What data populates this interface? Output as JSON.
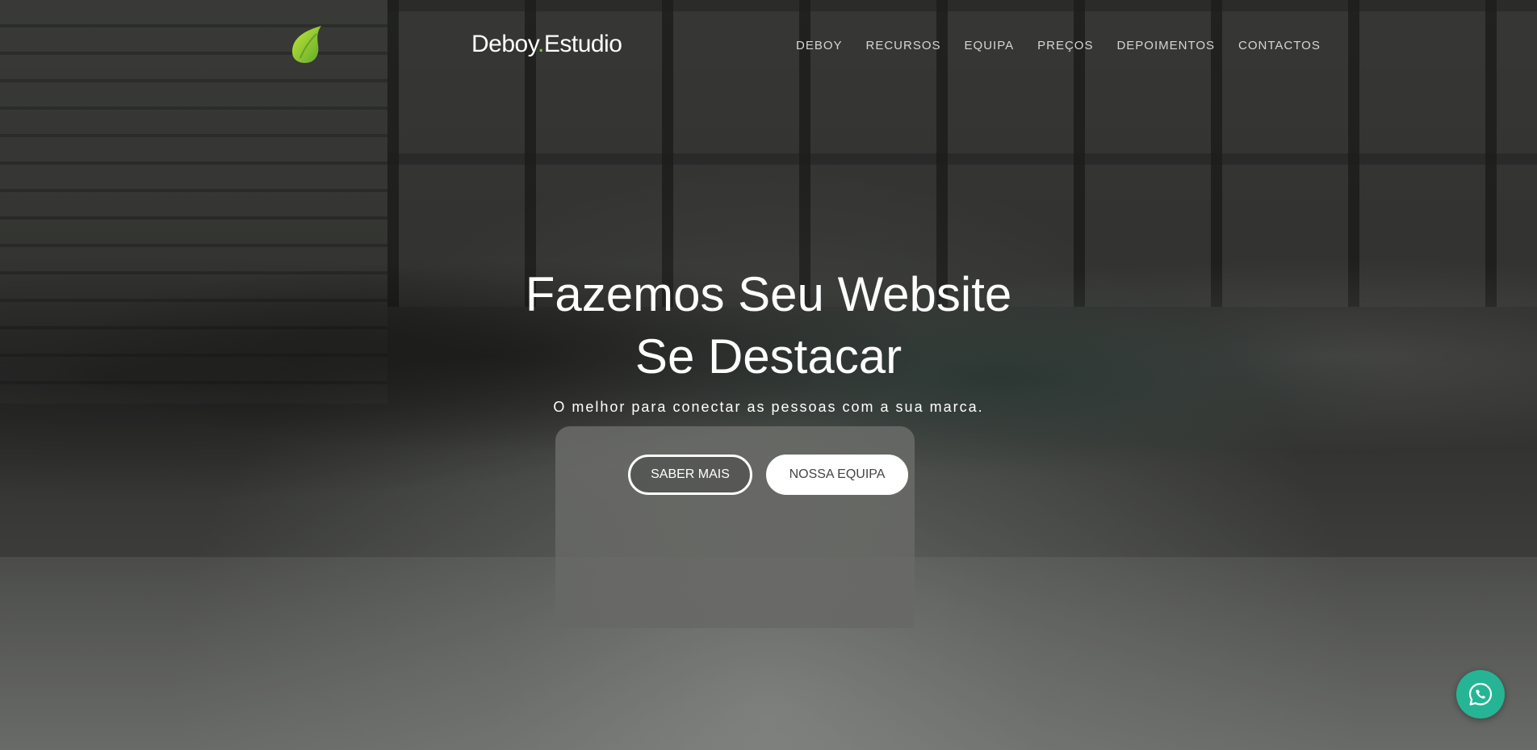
{
  "header": {
    "brand_name": "Deboy",
    "brand_dot": ".",
    "brand_suffix": "Estudio",
    "logo_icon": "green-leaf-drop-icon",
    "nav": [
      {
        "label": "DEBOY"
      },
      {
        "label": "RECURSOS"
      },
      {
        "label": "EQUIPA"
      },
      {
        "label": "PREÇOS"
      },
      {
        "label": "DEPOIMENTOS"
      },
      {
        "label": "CONTACTOS"
      }
    ]
  },
  "hero": {
    "title_line1": "Fazemos Seu Website",
    "title_line2": "Se Destacar",
    "subtitle": "O melhor para conectar as pessoas com a sua marca.",
    "primary_button": "SABER MAIS",
    "secondary_button": "NOSSA EQUIPA"
  },
  "floating": {
    "whatsapp_icon": "whatsapp-icon"
  },
  "colors": {
    "accent_green": "#8bc34a",
    "whatsapp_green": "#25b594"
  }
}
